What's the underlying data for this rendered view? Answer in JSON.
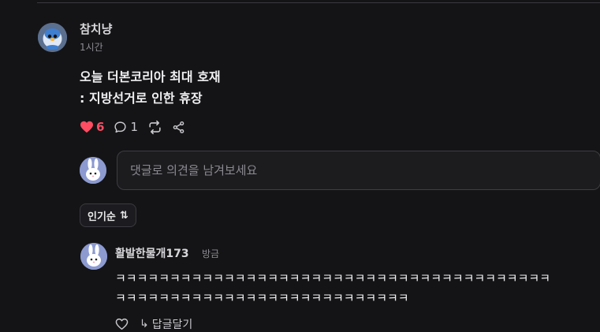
{
  "post": {
    "author": "참치냥",
    "time": "1시간",
    "lines": [
      "오늘 더본코리아 최대 호재",
      ": 지방선거로 인한 휴장"
    ],
    "likes": "6",
    "replies": "1"
  },
  "comment_box": {
    "placeholder": "댓글로 의견을 남겨보세요"
  },
  "sort": {
    "label": "인기순",
    "icon": "⇅"
  },
  "reply": {
    "author": "활발한물개173",
    "time": "방금",
    "lines": [
      "ㅋㅋㅋㅋㅋㅋㅋㅋㅋㅋㅋㅋㅋㅋㅋㅋㅋㅋㅋㅋㅋㅋㅋㅋㅋㅋㅋㅋㅋㅋㅋㅋㅋㅋㅋㅋㅋㅋㅋㅋ",
      "ㅋㅋㅋㅋㅋㅋㅋㅋㅋㅋㅋㅋㅋㅋㅋㅋㅋㅋㅋㅋㅋㅋㅋㅋㅋㅋㅋ"
    ],
    "reply_label": "답글달기"
  },
  "colors": {
    "background": "#141416",
    "like": "#ff4d63",
    "muted": "#8d8d93"
  },
  "icons": {
    "post_avatar": "penguin-avatar-icon",
    "user_avatar": "rabbit-avatar-icon",
    "like": "heart-filled-icon",
    "comment": "speech-bubble-icon",
    "repost": "repost-icon",
    "share": "share-icon",
    "reply_like": "heart-outline-icon",
    "reply_arrow": "reply-arrow-icon"
  }
}
